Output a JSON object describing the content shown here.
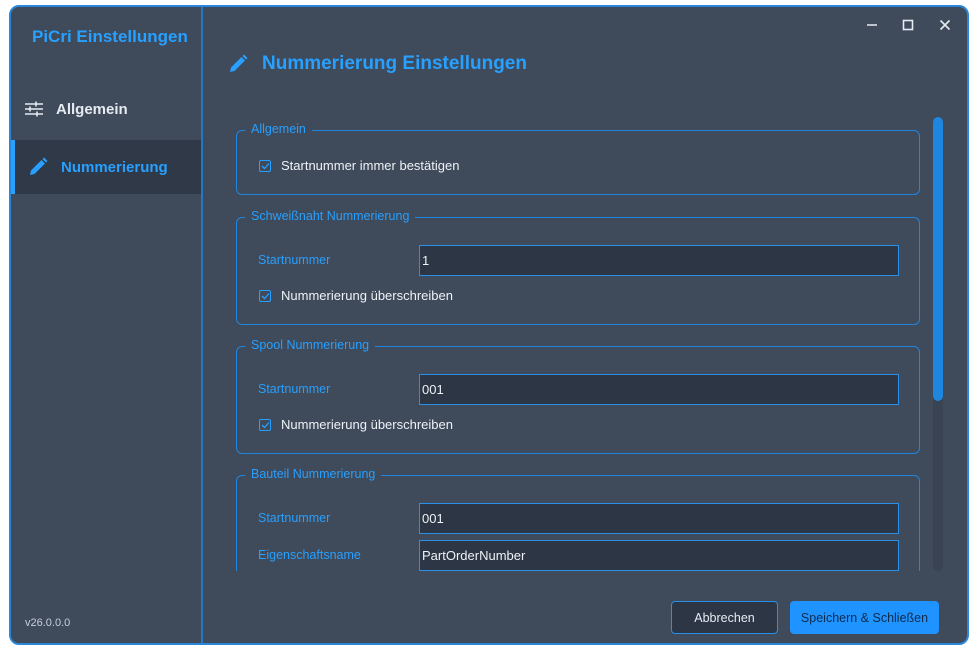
{
  "app": {
    "title": "PiCri Einstellungen",
    "version": "v26.0.0.0"
  },
  "window_controls": {
    "minimize_icon": "minimize-icon",
    "maximize_icon": "maximize-icon",
    "close_icon": "close-icon"
  },
  "sidebar": {
    "items": [
      {
        "label": "Allgemein",
        "icon": "sliders-icon",
        "selected": false
      },
      {
        "label": "Nummerierung",
        "icon": "pencil-icon",
        "selected": true
      }
    ]
  },
  "page": {
    "title": "Nummerierung Einstellungen",
    "icon": "pencil-icon"
  },
  "groups": {
    "general": {
      "title": "Allgemein",
      "confirm_start": {
        "label": "Startnummer immer bestätigen",
        "checked": true
      }
    },
    "weld": {
      "title": "Schweißnaht Nummerierung",
      "start_label": "Startnummer",
      "start_value": "1",
      "overwrite": {
        "label": "Nummerierung überschreiben",
        "checked": true
      }
    },
    "spool": {
      "title": "Spool Nummerierung",
      "start_label": "Startnummer",
      "start_value": "001",
      "overwrite": {
        "label": "Nummerierung überschreiben",
        "checked": true
      }
    },
    "part": {
      "title": "Bauteil Nummerierung",
      "start_label": "Startnummer",
      "start_value": "001",
      "property_label": "Eigenschaftsname",
      "property_value": "PartOrderNumber"
    }
  },
  "footer": {
    "cancel_label": "Abbrechen",
    "save_label": "Speichern & Schließen"
  },
  "colors": {
    "accent": "#27a0ff",
    "background": "#3f4a5a",
    "selected_nav": "#2f3948",
    "input_bg": "#2c3644"
  }
}
